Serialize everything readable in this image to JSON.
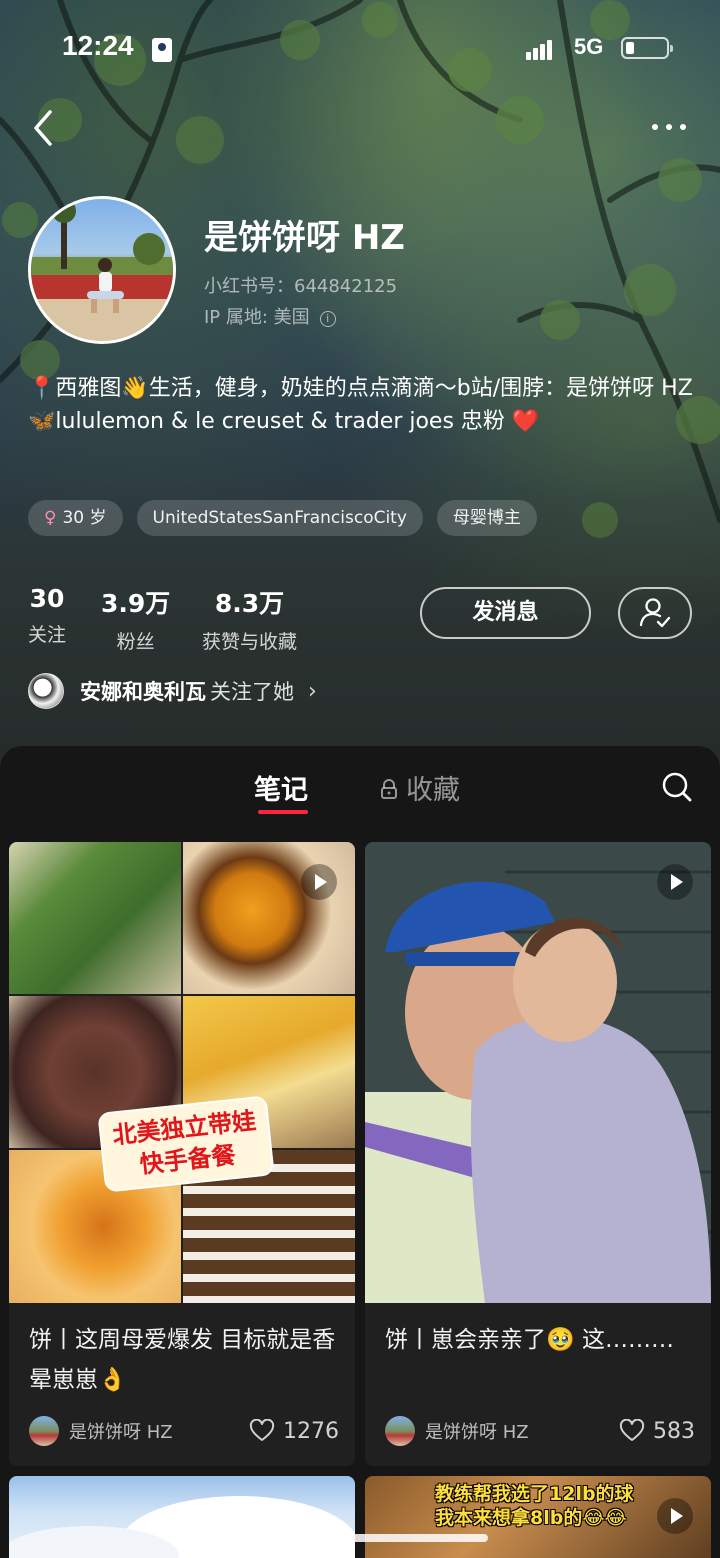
{
  "status_bar": {
    "time": "12:24",
    "network": "5G"
  },
  "profile": {
    "nickname": "是饼饼呀 HZ",
    "account_id": "小红书号：644842125",
    "ip_location": "IP 属地: 美国",
    "bio_line1": "📍西雅图👋生活，健身，奶娃的点点滴滴～b站/围脖：是饼饼呀 HZ",
    "bio_line2": "🦋lululemon & le creuset & trader joes 忠粉 ❤️",
    "tags": {
      "age": "30 岁",
      "location": "UnitedStatesSanFranciscoCity",
      "category": "母婴博主"
    }
  },
  "stats": {
    "following": {
      "value": "30",
      "label": "关注"
    },
    "followers": {
      "value": "3.9万",
      "label": "粉丝"
    },
    "likes": {
      "value": "8.3万",
      "label": "获赞与收藏"
    }
  },
  "actions": {
    "message_label": "发消息"
  },
  "mutual": {
    "name": "安娜和奥利瓦",
    "suffix": "关注了她"
  },
  "tabs": {
    "notes": "笔记",
    "collections": "收藏"
  },
  "notes": [
    {
      "title": "饼丨这周母爱爆发 目标就是香晕崽崽👌",
      "overlay_line1": "北美独立带娃",
      "overlay_line2": "快手备餐",
      "author": "是饼饼呀 HZ",
      "likes": "1276"
    },
    {
      "title": "饼丨崽会亲亲了🥹 这………",
      "author": "是饼饼呀 HZ",
      "likes": "583"
    },
    {
      "caption_line1": "教练帮我选了12lb的球",
      "caption_line2": "我本来想拿8lb的😂😂"
    }
  ],
  "colors": {
    "accent": "#ff2442",
    "panel": "#161616"
  }
}
